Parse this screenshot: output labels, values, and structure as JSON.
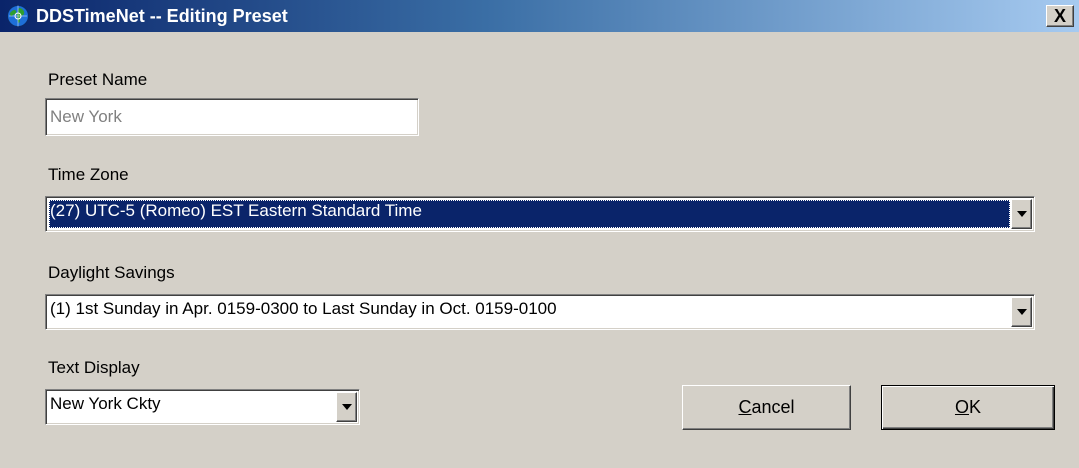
{
  "window": {
    "title": "DDSTimeNet -- Editing Preset",
    "close_label": "X"
  },
  "preset_name": {
    "label": "Preset Name",
    "value": "New York"
  },
  "time_zone": {
    "label": "Time Zone",
    "selected": "(27) UTC-5 (Romeo) EST Eastern Standard Time"
  },
  "daylight_savings": {
    "label": "Daylight Savings",
    "selected": "(1) 1st Sunday in Apr. 0159-0300 to Last Sunday in Oct. 0159-0100"
  },
  "text_display": {
    "label": "Text Display",
    "selected": "New York Ckty"
  },
  "buttons": {
    "cancel_mnemonic": "C",
    "cancel_rest": "ancel",
    "ok_mnemonic": "O",
    "ok_rest": "K"
  },
  "colors": {
    "title_start": "#0a246a",
    "title_end": "#a6caf0",
    "face": "#d4d0c8",
    "selection": "#0a246a"
  },
  "icons": {
    "app": "globe-icon",
    "close": "close-icon",
    "dropdown": "chevron-down-icon"
  }
}
